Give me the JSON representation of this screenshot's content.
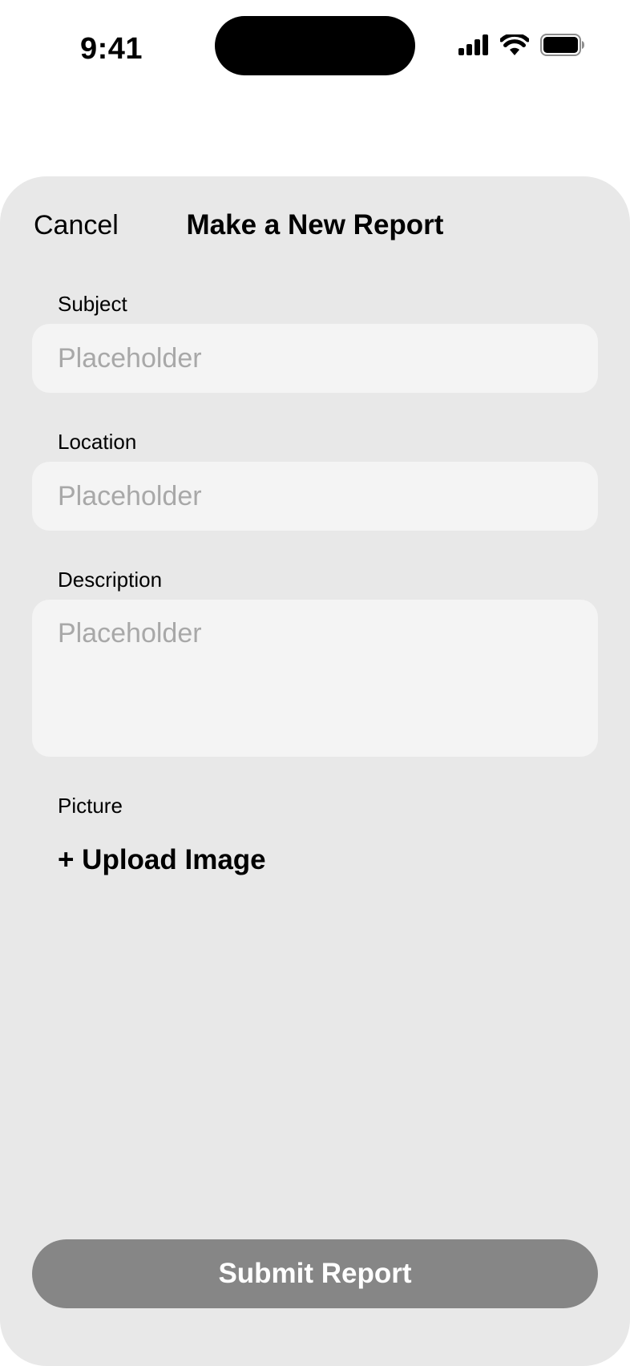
{
  "status_bar": {
    "time": "9:41",
    "icons": [
      "cellular-signal-icon",
      "wifi-icon",
      "battery-icon"
    ]
  },
  "sheet": {
    "cancel_label": "Cancel",
    "title": "Make a New Report",
    "fields": {
      "subject": {
        "label": "Subject",
        "placeholder": "Placeholder",
        "value": ""
      },
      "location": {
        "label": "Location",
        "placeholder": "Placeholder",
        "value": ""
      },
      "description": {
        "label": "Description",
        "placeholder": "Placeholder",
        "value": ""
      }
    },
    "picture": {
      "label": "Picture",
      "upload_label": "+ Upload Image"
    },
    "submit_label": "Submit Report"
  },
  "colors": {
    "sheet_background": "#e8e8e8",
    "input_background": "#f4f4f4",
    "placeholder_text": "#a8a8a8",
    "submit_button": "#868686",
    "submit_text": "#ffffff"
  }
}
